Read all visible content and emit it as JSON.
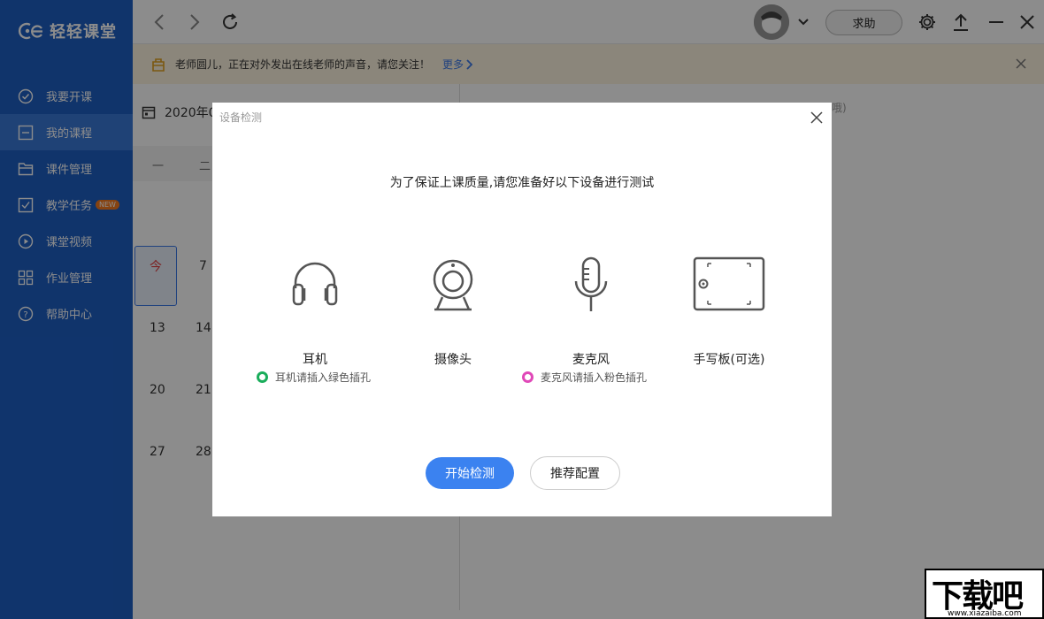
{
  "app": {
    "logo_text": "轻轻课堂"
  },
  "sidebar": {
    "items": [
      {
        "label": "我要开课",
        "icon": "check-circle-icon"
      },
      {
        "label": "我的课程",
        "icon": "course-icon"
      },
      {
        "label": "课件管理",
        "icon": "folder-icon"
      },
      {
        "label": "教学任务",
        "icon": "task-icon",
        "badge": "NEW"
      },
      {
        "label": "课堂视频",
        "icon": "play-icon"
      },
      {
        "label": "作业管理",
        "icon": "grid-icon"
      },
      {
        "label": "帮助中心",
        "icon": "question-icon"
      }
    ],
    "active_index": 1
  },
  "topbar": {
    "help_label": "求助"
  },
  "notice": {
    "text": "老师圆儿，正在对外发出在线老师的声音，请您关注！",
    "more_label": "更多"
  },
  "calendar": {
    "month_label": "2020年0",
    "weekdays": [
      "一",
      "二"
    ],
    "today_label": "今",
    "days": [
      "7",
      "13",
      "14",
      "20",
      "21",
      "27",
      "28"
    ]
  },
  "main": {
    "faded_text": "哦)"
  },
  "dialog": {
    "title": "设备检测",
    "heading": "为了保证上课质量,请您准备好以下设备进行测试",
    "devices": [
      {
        "label": "耳机",
        "icon": "headphones-icon"
      },
      {
        "label": "摄像头",
        "icon": "webcam-icon"
      },
      {
        "label": "麦克风",
        "icon": "microphone-icon"
      },
      {
        "label": "手写板(可选)",
        "icon": "tablet-icon"
      }
    ],
    "hints": [
      {
        "text": "耳机请插入绿色插孔",
        "color": "#1aad5b"
      },
      {
        "text": "麦克风请插入粉色插孔",
        "color": "#e048b8"
      }
    ],
    "start_label": "开始检测",
    "config_label": "推荐配置"
  },
  "colors": {
    "sidebar": "#1e5fc4",
    "active": "#3a78d8",
    "primary": "#3b82f0"
  },
  "watermark": {
    "big": "下载吧",
    "small": "www.xiazaiba.com"
  }
}
